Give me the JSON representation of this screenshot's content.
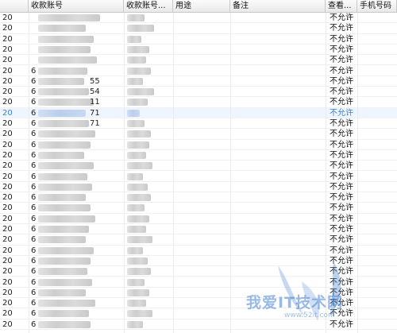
{
  "columns": [
    "",
    "收款账号",
    "收款账号...",
    "用途",
    "备注",
    "查看...",
    "手机号码"
  ],
  "rows": [
    {
      "c0": "20",
      "acct_prefix": "",
      "acct_digits": "",
      "perm": "不允许"
    },
    {
      "c0": "20",
      "acct_prefix": "",
      "acct_digits": "",
      "perm": "不允许"
    },
    {
      "c0": "20",
      "acct_prefix": "",
      "acct_digits": "",
      "perm": "不允许"
    },
    {
      "c0": "20",
      "acct_prefix": "",
      "acct_digits": "",
      "perm": "不允许"
    },
    {
      "c0": "20",
      "acct_prefix": "",
      "acct_digits": "",
      "perm": "不允许"
    },
    {
      "c0": "20",
      "acct_prefix": "6",
      "acct_digits": "",
      "perm": "不允许"
    },
    {
      "c0": "20",
      "acct_prefix": "6",
      "acct_digits": "55",
      "perm": "不允许"
    },
    {
      "c0": "20",
      "acct_prefix": "6",
      "acct_digits": "54",
      "perm": "不允许"
    },
    {
      "c0": "20",
      "acct_prefix": "6",
      "acct_digits": "11",
      "perm": "不允许"
    },
    {
      "c0": "20",
      "acct_prefix": "6",
      "acct_digits": "71",
      "perm": "不允许",
      "selected": true
    },
    {
      "c0": "20",
      "acct_prefix": "6",
      "acct_digits": "71",
      "perm": "不允许"
    },
    {
      "c0": "20",
      "acct_prefix": "6",
      "acct_digits": "",
      "perm": "不允许"
    },
    {
      "c0": "20",
      "acct_prefix": "6",
      "acct_digits": "",
      "perm": "不允许"
    },
    {
      "c0": "20",
      "acct_prefix": "6",
      "acct_digits": "",
      "perm": "不允许"
    },
    {
      "c0": "20",
      "acct_prefix": "6",
      "acct_digits": "",
      "perm": "不允许"
    },
    {
      "c0": "20",
      "acct_prefix": "6",
      "acct_digits": "",
      "perm": "不允许"
    },
    {
      "c0": "20",
      "acct_prefix": "6",
      "acct_digits": "",
      "perm": "不允许"
    },
    {
      "c0": "20",
      "acct_prefix": "6",
      "acct_digits": "",
      "perm": "不允许"
    },
    {
      "c0": "20",
      "acct_prefix": "6",
      "acct_digits": "",
      "perm": "不允许"
    },
    {
      "c0": "20",
      "acct_prefix": "6",
      "acct_digits": "",
      "perm": "不允许"
    },
    {
      "c0": "20",
      "acct_prefix": "6",
      "acct_digits": "",
      "perm": "不允许"
    },
    {
      "c0": "20",
      "acct_prefix": "6",
      "acct_digits": "",
      "perm": "不允许"
    },
    {
      "c0": "20",
      "acct_prefix": "6",
      "acct_digits": "",
      "perm": "不允许"
    },
    {
      "c0": "20",
      "acct_prefix": "6",
      "acct_digits": "",
      "perm": "不允许"
    },
    {
      "c0": "20",
      "acct_prefix": "6",
      "acct_digits": "",
      "perm": "不允许"
    },
    {
      "c0": "20",
      "acct_prefix": "6",
      "acct_digits": "",
      "perm": "不允许"
    },
    {
      "c0": "20",
      "acct_prefix": "6",
      "acct_digits": "",
      "perm": "不允许"
    },
    {
      "c0": "20",
      "acct_prefix": "6",
      "acct_digits": "",
      "perm": "不允许"
    },
    {
      "c0": "20",
      "acct_prefix": "6",
      "acct_digits": "",
      "perm": "不允许"
    },
    {
      "c0": "20",
      "acct_prefix": "6",
      "acct_digits": "",
      "perm": "不允许"
    }
  ],
  "watermark": {
    "text": "我爱IT技术网",
    "url": "www.52it.com"
  },
  "colors": {
    "selected_text": "#3b7ed4",
    "watermark": "#4682d2"
  }
}
